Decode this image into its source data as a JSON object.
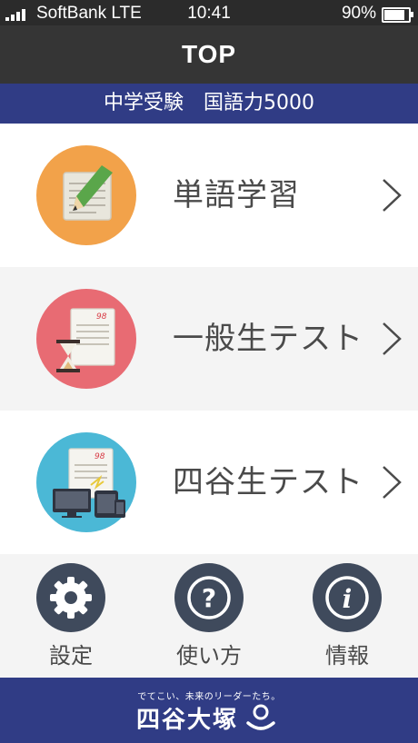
{
  "status_bar": {
    "carrier": "SoftBank  LTE",
    "time": "10:41",
    "battery": "90%"
  },
  "navbar": {
    "title": "TOP"
  },
  "subtitle": "中学受験　国語力5000",
  "menu": [
    {
      "label": "単語学習",
      "color": "#f2a24a",
      "icon": "notebook-pencil-icon"
    },
    {
      "label": "一般生テスト",
      "color": "#e86b73",
      "icon": "test-hourglass-icon"
    },
    {
      "label": "四谷生テスト",
      "color": "#4bb8d6",
      "icon": "test-devices-icon"
    }
  ],
  "tools": [
    {
      "label": "設定",
      "icon": "gear-icon"
    },
    {
      "label": "使い方",
      "icon": "question-icon"
    },
    {
      "label": "情報",
      "icon": "info-icon"
    }
  ],
  "footer": {
    "tagline": "でてこい、未来のリーダーたち。",
    "brand": "四谷大塚"
  },
  "colors": {
    "navbar": "#353535",
    "accent_blue": "#303c85",
    "tool_icon_bg": "#3f4a5c"
  }
}
